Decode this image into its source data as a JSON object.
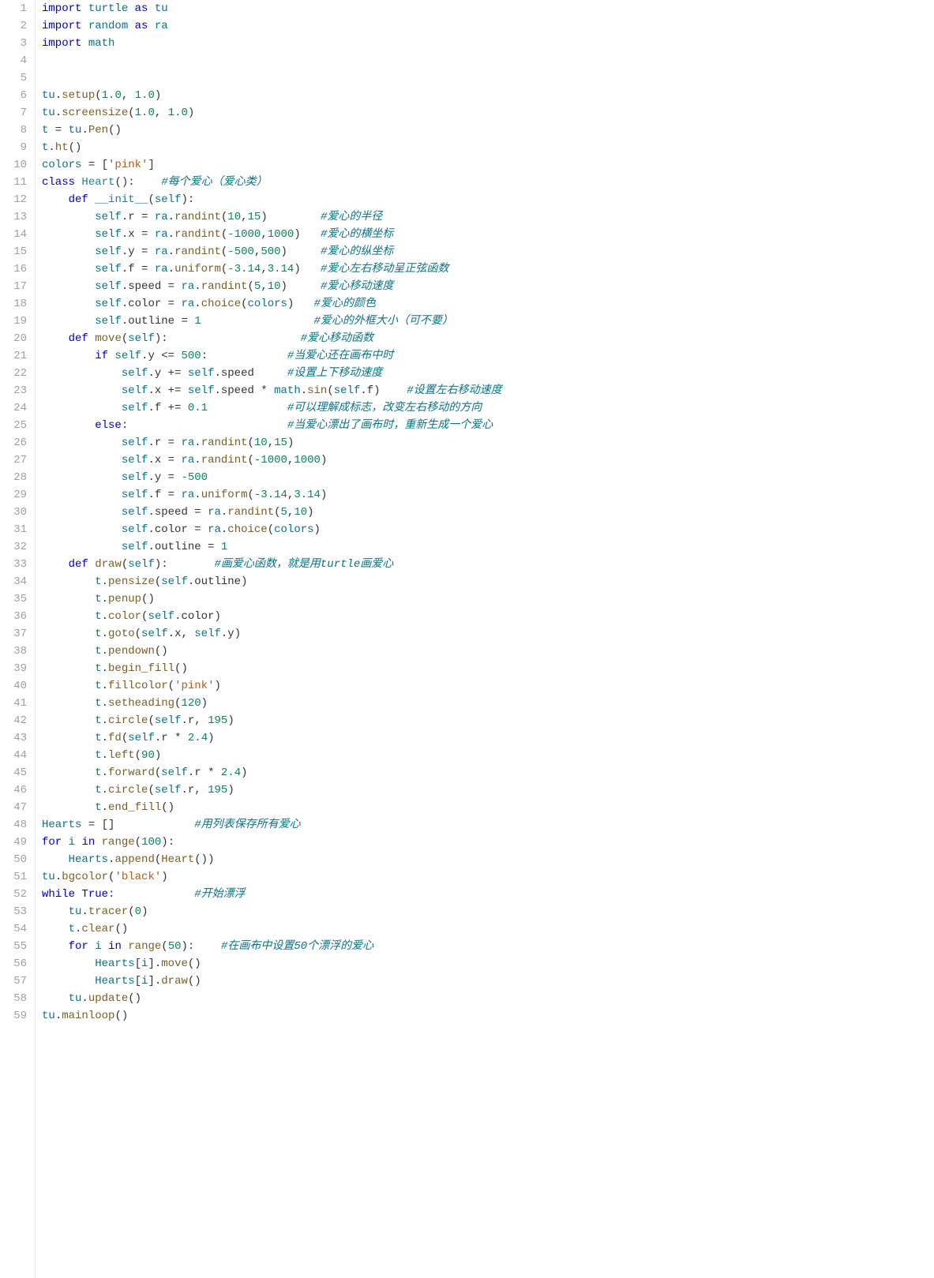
{
  "lines": [
    {
      "n": "1",
      "html": "<span class=\"kw\">import</span> <span class=\"mod\">turtle</span> <span class=\"kw\">as</span> <span class=\"mod\">tu</span>"
    },
    {
      "n": "2",
      "html": "<span class=\"kw\">import</span> <span class=\"mod\">random</span> <span class=\"kw\">as</span> <span class=\"mod\">ra</span>"
    },
    {
      "n": "3",
      "html": "<span class=\"kw\">import</span> <span class=\"mod\">math</span>"
    },
    {
      "n": "4",
      "html": ""
    },
    {
      "n": "5",
      "html": ""
    },
    {
      "n": "6",
      "html": "<span class=\"mod\">tu</span>.<span class=\"fn\">setup</span>(<span class=\"num\">1.0</span>, <span class=\"num\">1.0</span>)"
    },
    {
      "n": "7",
      "html": "<span class=\"mod\">tu</span>.<span class=\"fn\">screensize</span>(<span class=\"num\">1.0</span>, <span class=\"num\">1.0</span>)"
    },
    {
      "n": "8",
      "html": "<span class=\"mod\">t</span> = <span class=\"mod\">tu</span>.<span class=\"fn\">Pen</span>()"
    },
    {
      "n": "9",
      "html": "<span class=\"mod\">t</span>.<span class=\"fn\">ht</span>()"
    },
    {
      "n": "10",
      "html": "<span class=\"mod\">colors</span> = [<span class=\"str\">'pink'</span>]"
    },
    {
      "n": "11",
      "html": "<span class=\"kw\">class</span> <span class=\"cls\">Heart</span>():    <span class=\"cm\">#每个爱心（爱心类）</span>"
    },
    {
      "n": "12",
      "html": "    <span class=\"kw\">def</span> <span class=\"dunder\">__init__</span>(<span class=\"mod\">self</span>):"
    },
    {
      "n": "13",
      "html": "        <span class=\"mod\">self</span>.<span class=\"prop2\">r</span> = <span class=\"mod\">ra</span>.<span class=\"fn\">randint</span>(<span class=\"num\">10</span>,<span class=\"num\">15</span>)        <span class=\"cm\">#爱心的半径</span>"
    },
    {
      "n": "14",
      "html": "        <span class=\"mod\">self</span>.<span class=\"prop2\">x</span> = <span class=\"mod\">ra</span>.<span class=\"fn\">randint</span>(<span class=\"num\">-1000</span>,<span class=\"num\">1000</span>)   <span class=\"cm\">#爱心的横坐标</span>"
    },
    {
      "n": "15",
      "html": "        <span class=\"mod\">self</span>.<span class=\"prop2\">y</span> = <span class=\"mod\">ra</span>.<span class=\"fn\">randint</span>(<span class=\"num\">-500</span>,<span class=\"num\">500</span>)     <span class=\"cm\">#爱心的纵坐标</span>"
    },
    {
      "n": "16",
      "html": "        <span class=\"mod\">self</span>.<span class=\"prop2\">f</span> = <span class=\"mod\">ra</span>.<span class=\"fn\">uniform</span>(<span class=\"num\">-3.14</span>,<span class=\"num\">3.14</span>)   <span class=\"cm\">#爱心左右移动呈正弦函数</span>"
    },
    {
      "n": "17",
      "html": "        <span class=\"mod\">self</span>.<span class=\"prop2\">speed</span> = <span class=\"mod\">ra</span>.<span class=\"fn\">randint</span>(<span class=\"num\">5</span>,<span class=\"num\">10</span>)     <span class=\"cm\">#爱心移动速度</span>"
    },
    {
      "n": "18",
      "html": "        <span class=\"mod\">self</span>.<span class=\"prop2\">color</span> = <span class=\"mod\">ra</span>.<span class=\"fn\">choice</span>(<span class=\"mod\">colors</span>)   <span class=\"cm\">#爱心的颜色</span>"
    },
    {
      "n": "19",
      "html": "        <span class=\"mod\">self</span>.<span class=\"prop2\">outline</span> = <span class=\"num\">1</span>                 <span class=\"cm\">#爱心的外框大小（可不要）</span>"
    },
    {
      "n": "20",
      "html": "    <span class=\"kw\">def</span> <span class=\"fn\">move</span>(<span class=\"mod\">self</span>):                    <span class=\"cm\">#爱心移动函数</span>"
    },
    {
      "n": "21",
      "html": "        <span class=\"kw\">if</span> <span class=\"mod\">self</span>.<span class=\"prop2\">y</span> &lt;= <span class=\"num\">500</span>:            <span class=\"cm\">#当爱心还在画布中时</span>"
    },
    {
      "n": "22",
      "html": "            <span class=\"mod\">self</span>.<span class=\"prop2\">y</span> += <span class=\"mod\">self</span>.<span class=\"prop2\">speed</span>     <span class=\"cm\">#设置上下移动速度</span>"
    },
    {
      "n": "23",
      "html": "            <span class=\"mod\">self</span>.<span class=\"prop2\">x</span> += <span class=\"mod\">self</span>.<span class=\"prop2\">speed</span> * <span class=\"mod\">math</span>.<span class=\"fn\">sin</span>(<span class=\"mod\">self</span>.<span class=\"prop2\">f</span>)    <span class=\"cm\">#设置左右移动速度</span>"
    },
    {
      "n": "24",
      "html": "            <span class=\"mod\">self</span>.<span class=\"prop2\">f</span> += <span class=\"num\">0.1</span>            <span class=\"cm\">#可以理解成标志，改变左右移动的方向</span>"
    },
    {
      "n": "25",
      "html": "        <span class=\"kw\">else</span>:                        <span class=\"cm\">#当爱心漂出了画布时，重新生成一个爱心</span>"
    },
    {
      "n": "26",
      "html": "            <span class=\"mod\">self</span>.<span class=\"prop2\">r</span> = <span class=\"mod\">ra</span>.<span class=\"fn\">randint</span>(<span class=\"num\">10</span>,<span class=\"num\">15</span>)"
    },
    {
      "n": "27",
      "html": "            <span class=\"mod\">self</span>.<span class=\"prop2\">x</span> = <span class=\"mod\">ra</span>.<span class=\"fn\">randint</span>(<span class=\"num\">-1000</span>,<span class=\"num\">1000</span>)"
    },
    {
      "n": "28",
      "html": "            <span class=\"mod\">self</span>.<span class=\"prop2\">y</span> = <span class=\"num\">-500</span>"
    },
    {
      "n": "29",
      "html": "            <span class=\"mod\">self</span>.<span class=\"prop2\">f</span> = <span class=\"mod\">ra</span>.<span class=\"fn\">uniform</span>(<span class=\"num\">-3.14</span>,<span class=\"num\">3.14</span>)"
    },
    {
      "n": "30",
      "html": "            <span class=\"mod\">self</span>.<span class=\"prop2\">speed</span> = <span class=\"mod\">ra</span>.<span class=\"fn\">randint</span>(<span class=\"num\">5</span>,<span class=\"num\">10</span>)"
    },
    {
      "n": "31",
      "html": "            <span class=\"mod\">self</span>.<span class=\"prop2\">color</span> = <span class=\"mod\">ra</span>.<span class=\"fn\">choice</span>(<span class=\"mod\">colors</span>)"
    },
    {
      "n": "32",
      "html": "            <span class=\"mod\">self</span>.<span class=\"prop2\">outline</span> = <span class=\"num\">1</span>"
    },
    {
      "n": "33",
      "html": "    <span class=\"kw\">def</span> <span class=\"fn\">draw</span>(<span class=\"mod\">self</span>):       <span class=\"cm\">#画爱心函数，就是用turtle画爱心</span>"
    },
    {
      "n": "34",
      "html": "        <span class=\"mod\">t</span>.<span class=\"fn\">pensize</span>(<span class=\"mod\">self</span>.<span class=\"prop2\">outline</span>)"
    },
    {
      "n": "35",
      "html": "        <span class=\"mod\">t</span>.<span class=\"fn\">penup</span>()"
    },
    {
      "n": "36",
      "html": "        <span class=\"mod\">t</span>.<span class=\"fn\">color</span>(<span class=\"mod\">self</span>.<span class=\"prop2\">color</span>)"
    },
    {
      "n": "37",
      "html": "        <span class=\"mod\">t</span>.<span class=\"fn\">goto</span>(<span class=\"mod\">self</span>.<span class=\"prop2\">x</span>, <span class=\"mod\">self</span>.<span class=\"prop2\">y</span>)"
    },
    {
      "n": "38",
      "html": "        <span class=\"mod\">t</span>.<span class=\"fn\">pendown</span>()"
    },
    {
      "n": "39",
      "html": "        <span class=\"mod\">t</span>.<span class=\"fn\">begin_fill</span>()"
    },
    {
      "n": "40",
      "html": "        <span class=\"mod\">t</span>.<span class=\"fn\">fillcolor</span>(<span class=\"str\">'pink'</span>)"
    },
    {
      "n": "41",
      "html": "        <span class=\"mod\">t</span>.<span class=\"fn\">setheading</span>(<span class=\"num\">120</span>)"
    },
    {
      "n": "42",
      "html": "        <span class=\"mod\">t</span>.<span class=\"fn\">circle</span>(<span class=\"mod\">self</span>.<span class=\"prop2\">r</span>, <span class=\"num\">195</span>)"
    },
    {
      "n": "43",
      "html": "        <span class=\"mod\">t</span>.<span class=\"fn\">fd</span>(<span class=\"mod\">self</span>.<span class=\"prop2\">r</span> * <span class=\"num\">2.4</span>)"
    },
    {
      "n": "44",
      "html": "        <span class=\"mod\">t</span>.<span class=\"fn\">left</span>(<span class=\"num\">90</span>)"
    },
    {
      "n": "45",
      "html": "        <span class=\"mod\">t</span>.<span class=\"fn\">forward</span>(<span class=\"mod\">self</span>.<span class=\"prop2\">r</span> * <span class=\"num\">2.4</span>)"
    },
    {
      "n": "46",
      "html": "        <span class=\"mod\">t</span>.<span class=\"fn\">circle</span>(<span class=\"mod\">self</span>.<span class=\"prop2\">r</span>, <span class=\"num\">195</span>)"
    },
    {
      "n": "47",
      "html": "        <span class=\"mod\">t</span>.<span class=\"fn\">end_fill</span>()"
    },
    {
      "n": "48",
      "html": "<span class=\"mod\">Hearts</span> = []            <span class=\"cm\">#用列表保存所有爱心</span>"
    },
    {
      "n": "49",
      "html": "<span class=\"kw\">for</span> <span class=\"mod\">i</span> <span class=\"kw\">in</span> <span class=\"fn\">range</span>(<span class=\"num\">100</span>):"
    },
    {
      "n": "50",
      "html": "    <span class=\"mod\">Hearts</span>.<span class=\"fn\">append</span>(<span class=\"fn\">Heart</span>())"
    },
    {
      "n": "51",
      "html": "<span class=\"mod\">tu</span>.<span class=\"fn\">bgcolor</span>(<span class=\"str\">'black'</span>)"
    },
    {
      "n": "52",
      "html": "<span class=\"kw\">while</span> <span class=\"const\">True</span>:            <span class=\"cm\">#开始漂浮</span>"
    },
    {
      "n": "53",
      "html": "    <span class=\"mod\">tu</span>.<span class=\"fn\">tracer</span>(<span class=\"num\">0</span>)"
    },
    {
      "n": "54",
      "html": "    <span class=\"mod\">t</span>.<span class=\"fn\">clear</span>()"
    },
    {
      "n": "55",
      "html": "    <span class=\"kw\">for</span> <span class=\"mod\">i</span> <span class=\"kw\">in</span> <span class=\"fn\">range</span>(<span class=\"num\">50</span>):    <span class=\"cm\">#在画布中设置50个漂浮的爱心</span>"
    },
    {
      "n": "56",
      "html": "        <span class=\"mod\">Hearts</span>[<span class=\"mod\">i</span>].<span class=\"fn\">move</span>()"
    },
    {
      "n": "57",
      "html": "        <span class=\"mod\">Hearts</span>[<span class=\"mod\">i</span>].<span class=\"fn\">draw</span>()"
    },
    {
      "n": "58",
      "html": "    <span class=\"mod\">tu</span>.<span class=\"fn\">update</span>()"
    },
    {
      "n": "59",
      "html": "<span class=\"mod\">tu</span>.<span class=\"fn\">mainloop</span>()"
    }
  ]
}
